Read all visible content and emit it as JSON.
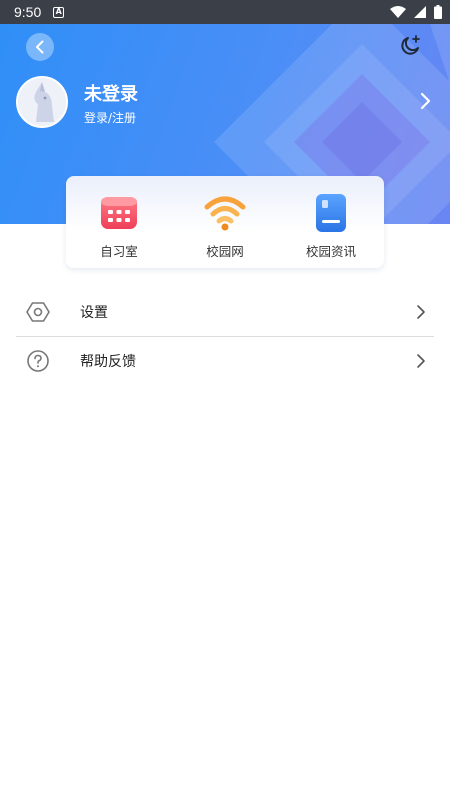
{
  "status_bar": {
    "time": "9:50"
  },
  "profile": {
    "name": "未登录",
    "login_link": "登录/注册"
  },
  "quick_actions": [
    {
      "label": "自习室",
      "icon": "calendar-grid-icon",
      "color": "#f2566a"
    },
    {
      "label": "校园网",
      "icon": "wifi-icon",
      "color": "#f7a23a"
    },
    {
      "label": "校园资讯",
      "icon": "book-icon",
      "color": "#3a86f0"
    }
  ],
  "menu": [
    {
      "label": "设置",
      "icon": "hexagon-settings-icon"
    },
    {
      "label": "帮助反馈",
      "icon": "help-circle-icon"
    }
  ],
  "colors": {
    "brand": "#3a8cf6",
    "background": "#ffffff"
  }
}
